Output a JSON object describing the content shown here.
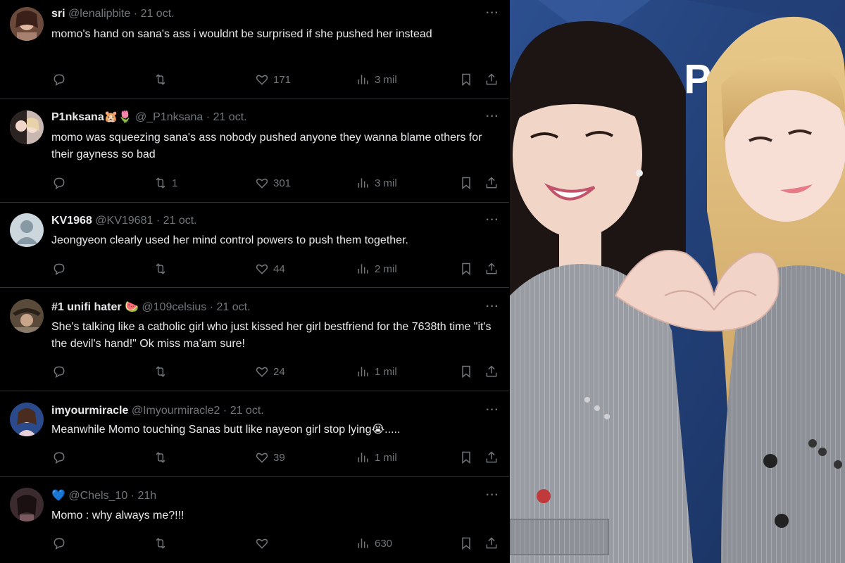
{
  "tweets": [
    {
      "name": "sri",
      "handle": "@lenalipbite",
      "time": "21 oct.",
      "text": "momo's hand on sana's ass i wouldnt be surprised if she pushed her instead",
      "replies": "",
      "retweets": "",
      "likes": "171",
      "views": "3 mil"
    },
    {
      "name": "P1nksana",
      "name_emoji": "🐹🌷",
      "handle": "@_P1nksana",
      "time": "21 oct.",
      "text": "momo was squeezing sana's ass nobody pushed anyone they wanna blame others for their gayness so bad",
      "replies": "",
      "retweets": "1",
      "likes": "301",
      "views": "3 mil"
    },
    {
      "name": "KV1968",
      "handle": "@KV19681",
      "time": "21 oct.",
      "text": "Jeongyeon clearly used her mind control powers to push them together.",
      "replies": "",
      "retweets": "",
      "likes": "44",
      "views": "2 mil"
    },
    {
      "name": "#1 unifi hater",
      "name_emoji": "🍉",
      "handle": "@109celsius",
      "time": "21 oct.",
      "text": "She's talking like a catholic girl who just kissed her girl bestfriend for the 7638th time \"it's the devil's hand!\" Ok miss ma'am sure!",
      "replies": "",
      "retweets": "",
      "likes": "24",
      "views": "1 mil"
    },
    {
      "name": "imyourmiracle",
      "handle": "@Imyourmiracle2",
      "time": "21 oct.",
      "text": "Meanwhile Momo touching Sanas butt like nayeon girl stop lying😭.....",
      "replies": "",
      "retweets": "",
      "likes": "39",
      "views": "1 mil"
    },
    {
      "name": "",
      "name_emoji": "💙",
      "handle": "@Chels_10",
      "time": "21h",
      "text": "Momo : why always me?!!!",
      "replies": "",
      "retweets": "",
      "likes": "",
      "views": "630"
    }
  ],
  "separator": "·",
  "more_label": "···",
  "photo": {
    "backdrop_text": "K·P"
  },
  "colors": {
    "background": "#000000",
    "text": "#e7e9ea",
    "muted": "#71767b",
    "divider": "#2f3336",
    "backdrop": "#1f3f7a"
  },
  "icons": [
    "reply-icon",
    "retweet-icon",
    "like-icon",
    "views-icon",
    "bookmark-icon",
    "share-icon",
    "more-icon"
  ]
}
